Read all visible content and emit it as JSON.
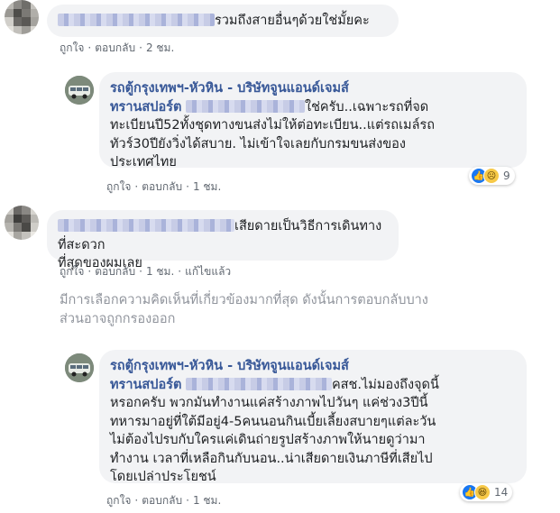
{
  "comments": [
    {
      "text": "รวมถึงสายอื่นๆด้วยใช่มั้ยคะ",
      "actions": {
        "like": "ถูกใจ",
        "reply": "ตอบกลับ",
        "time": "2 ชม."
      }
    },
    {
      "author": "รถตู้กรุงเทพฯ-หัวหิน - บริษัทจูนแอนด์เจมส์ ทรานสปอร์ต",
      "author_line1": "รถตู้กรุงเทพฯ-หัวหิน - บริษัทจูนแอนด์เจมส์",
      "author_line2": "ทรานสปอร์ต",
      "lines": [
        "ใช่ครับ..เฉพาะรถที่จด",
        "ทะเบียนปี52ทั้งชุดทางขนส่งไม่ให้ต่อทะเบียน..แต่รถเมล์รถ",
        "ทัวร์30ปียังวิ่งได้สบาย. ไม่เข้าใจเลยกับกรมขนส่งของ",
        "ประเทศไทย"
      ],
      "reactions": {
        "count": "9",
        "icons": [
          "like-icon",
          "sad-icon"
        ]
      },
      "actions": {
        "like": "ถูกใจ",
        "reply": "ตอบกลับ",
        "time": "1 ชม."
      }
    },
    {
      "lines": [
        "เสียดายเป็นวิธีการเดินทางที่สะดวก",
        "ที่สุดของผมเลย"
      ],
      "actions": {
        "reply": "ตอบกลับ",
        "time": "1 ชม.",
        "edited": "แก้ไขแล้ว",
        "like": "ถูกใจ"
      }
    },
    {
      "author": "รถตู้กรุงเทพฯ-หัวหิน - บริษัทจูนแอนด์เจมส์ ทรานสปอร์ต",
      "author_line1": "รถตู้กรุงเทพฯ-หัวหิน - บริษัทจูนแอนด์เจมส์",
      "author_line2": "ทรานสปอร์ต",
      "lines": [
        "คสช.ไม่มองถึงจุดนี้",
        "หรอกครับ พวกมันทำงานแค่สร้างภาพไปวันๆ แค่ช่วง3ปีนี้",
        "ทหารมาอยู่ที่ใต้มีอยู่4-5คนนอนกินเบี้ยเลี้ยงสบายๆแต่ละวัน",
        "ไม่ต้องไปรบกับใครแค่เดินถ่ายรูปสร้างภาพให้นายดูว่ามา",
        "ทำงาน เวลาที่เหลือกินกับนอน..น่าเสียดายเงินภาษีที่เสียไป",
        "โดยเปล่าประโยชน์"
      ],
      "reactions": {
        "count": "14",
        "icons": [
          "like-icon",
          "haha-icon"
        ]
      },
      "actions": {
        "like": "ถูกใจ",
        "reply": "ตอบกลับ",
        "time": "1 ชม."
      }
    }
  ],
  "notice": {
    "line1": "มีการเลือกความคิดเห็นที่เกี่ยวข้องมากที่สุด ดังนั้นการตอบกลับบาง",
    "line2": "ส่วนอาจถูกกรองออก"
  }
}
